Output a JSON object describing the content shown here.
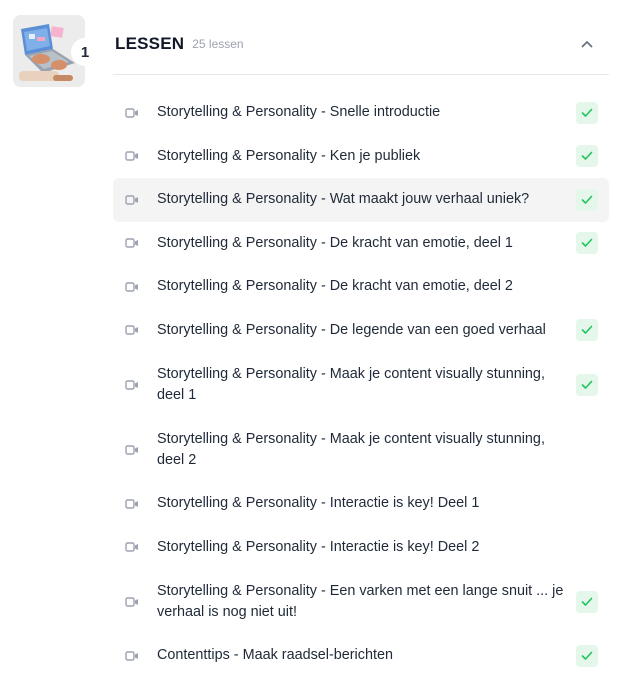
{
  "module": {
    "number": "1"
  },
  "header": {
    "title": "LESSEN",
    "count": "25 lessen"
  },
  "colors": {
    "check_green": "#22c55e",
    "check_bg": "#e4f7ea",
    "video_icon": "#9ca3af",
    "highlight": "#f4f4f5"
  },
  "lessons": [
    {
      "title": "Storytelling & Personality - Snelle introductie",
      "completed": true
    },
    {
      "title": "Storytelling & Personality - Ken je publiek",
      "completed": true
    },
    {
      "title": "Storytelling & Personality - Wat maakt jouw verhaal uniek?",
      "completed": true
    },
    {
      "title": "Storytelling & Personality - De kracht van emotie, deel 1",
      "completed": true
    },
    {
      "title": "Storytelling & Personality - De kracht van emotie, deel 2",
      "completed": false
    },
    {
      "title": "Storytelling & Personality - De legende van een goed verhaal",
      "completed": true
    },
    {
      "title": "Storytelling & Personality - Maak je content visually stunning, deel 1",
      "completed": true
    },
    {
      "title": "Storytelling & Personality - Maak je content visually stunning, deel 2",
      "completed": false
    },
    {
      "title": "Storytelling & Personality - Interactie is key! Deel 1",
      "completed": false
    },
    {
      "title": "Storytelling & Personality - Interactie is key! Deel 2",
      "completed": false
    },
    {
      "title": "Storytelling & Personality - Een varken met een lange snuit ... je verhaal is nog niet uit!",
      "completed": true
    },
    {
      "title": "Contenttips - Maak raadsel-berichten",
      "completed": true
    }
  ]
}
